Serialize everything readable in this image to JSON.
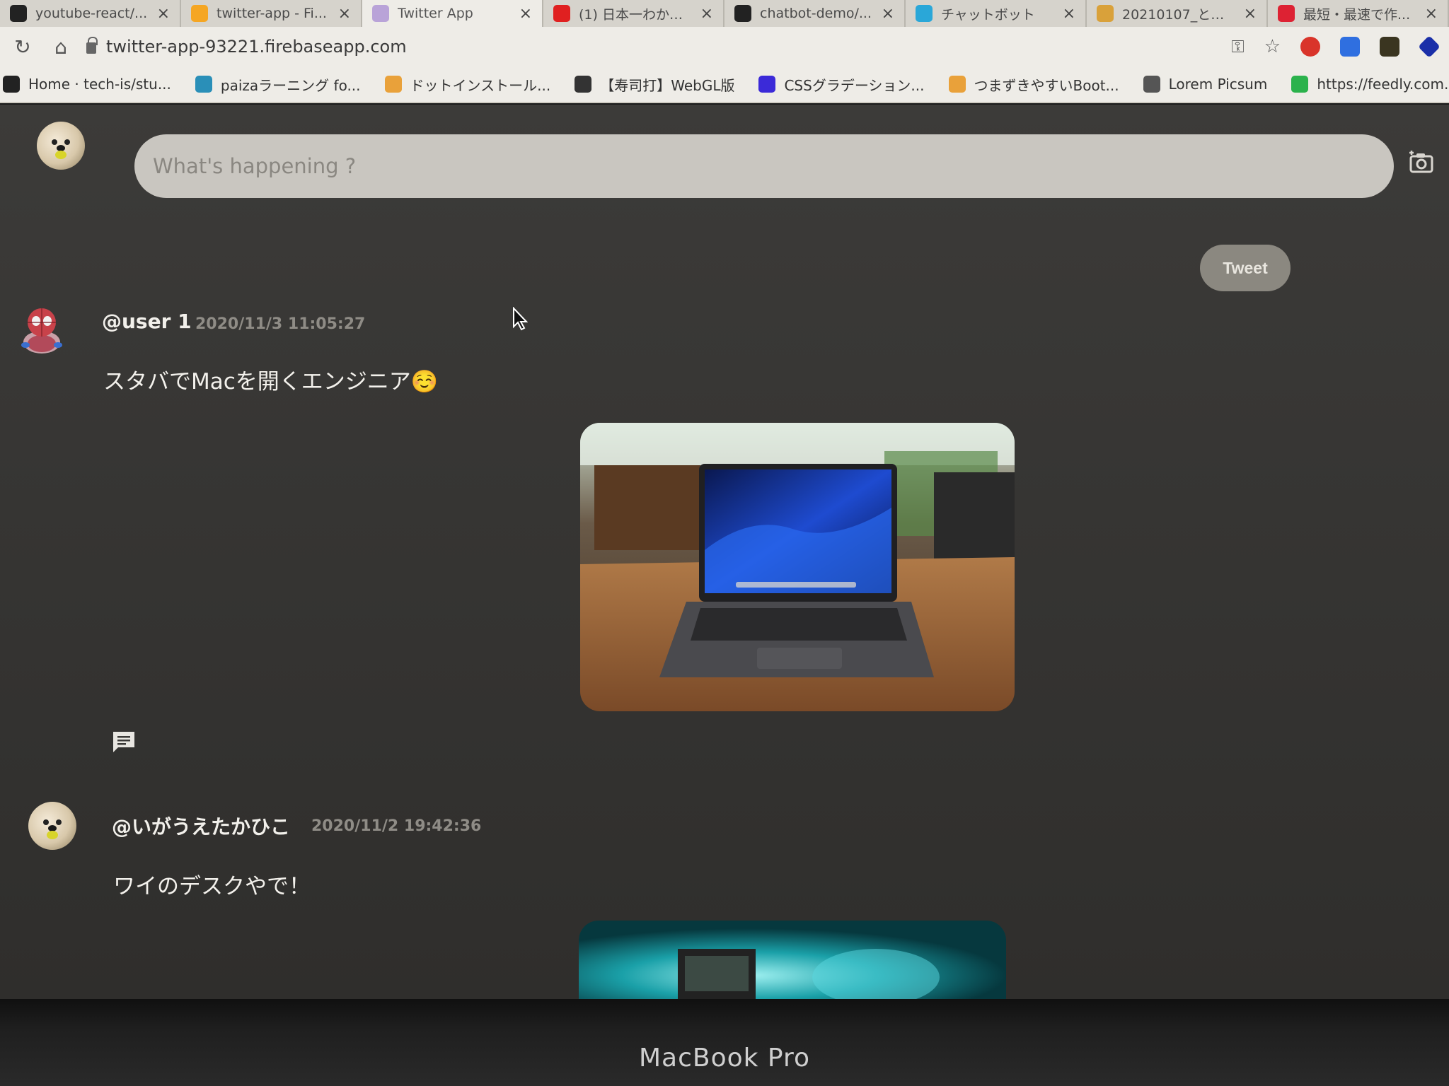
{
  "browser": {
    "tabs": [
      {
        "label": "youtube-react/...",
        "favicon": "github-icon",
        "color": "#222222"
      },
      {
        "label": "twitter-app - Fi...",
        "favicon": "firebase-icon",
        "color": "#f5a623"
      },
      {
        "label": "Twitter App",
        "favicon": "react-icon",
        "color": "#b9a3d8",
        "active": true
      },
      {
        "label": "(1) 日本一わかり...",
        "favicon": "youtube-icon",
        "color": "#e02020"
      },
      {
        "label": "chatbot-demo/...",
        "favicon": "github-icon",
        "color": "#222222"
      },
      {
        "label": "チャットボット",
        "favicon": "react-icon",
        "color": "#2aa7d8"
      },
      {
        "label": "20210107_とらい...",
        "favicon": "image-icon",
        "color": "#d9a13a"
      },
      {
        "label": "最短・最速で作...",
        "favicon": "brand-icon",
        "color": "#d23"
      }
    ],
    "url": "twitter-app-93221.firebaseapp.com",
    "bookmarks": [
      {
        "label": "Home · tech-is/stu...",
        "icon": "github-icon",
        "color": "#222222"
      },
      {
        "label": "paizaラーニング fo...",
        "icon": "paiza-icon",
        "color": "#2a8fb8"
      },
      {
        "label": "ドットインストール...",
        "icon": "dotinstall-icon",
        "color": "#e9a13a"
      },
      {
        "label": "【寿司打】WebGL版",
        "icon": "sushi-icon",
        "color": "#333333"
      },
      {
        "label": "CSSグラデーション...",
        "icon": "css-icon",
        "color": "#3b2ad8"
      },
      {
        "label": "つまずきやすいBoot...",
        "icon": "flame-icon",
        "color": "#e9a13a"
      },
      {
        "label": "Lorem Picsum",
        "icon": "image-icon",
        "color": "#555555"
      },
      {
        "label": "https://feedly.com...",
        "icon": "feedly-icon",
        "color": "#2bb24c"
      }
    ]
  },
  "compose": {
    "placeholder": "What's happening ?",
    "tweet_label": "Tweet"
  },
  "posts": [
    {
      "username": "@user 1",
      "timestamp": "2020/11/3 11:05:27",
      "text": "スタバでMacを開くエンジニア☺️"
    },
    {
      "username": "@いがうえたかひこ",
      "timestamp": "2020/11/2 19:42:36",
      "text": "ワイのデスクやで！"
    }
  ],
  "device": {
    "label": "MacBook Pro"
  }
}
